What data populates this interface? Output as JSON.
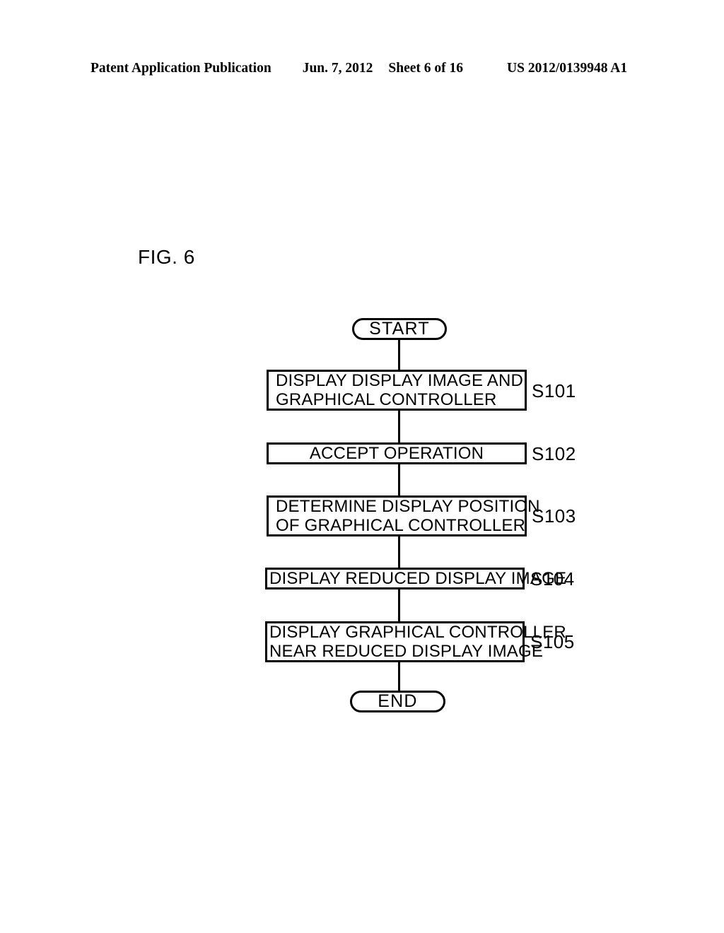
{
  "header": {
    "publication": "Patent Application Publication",
    "date": "Jun. 7, 2012",
    "sheet": "Sheet 6 of 16",
    "patent_number": "US 2012/0139948 A1"
  },
  "figure": {
    "label": "FIG. 6"
  },
  "flowchart": {
    "start": {
      "label": "START"
    },
    "end": {
      "label": "END"
    },
    "steps": [
      {
        "id": "S101",
        "line1": "DISPLAY DISPLAY IMAGE AND",
        "line2": "GRAPHICAL CONTROLLER"
      },
      {
        "id": "S102",
        "line1": "ACCEPT OPERATION",
        "line2": ""
      },
      {
        "id": "S103",
        "line1": "DETERMINE DISPLAY POSITION",
        "line2": "OF GRAPHICAL CONTROLLER"
      },
      {
        "id": "S104",
        "line1": "DISPLAY REDUCED DISPLAY IMAGE",
        "line2": ""
      },
      {
        "id": "S105",
        "line1": "DISPLAY GRAPHICAL CONTROLLER",
        "line2": "NEAR REDUCED DISPLAY IMAGE"
      }
    ]
  },
  "colors": {
    "ink": "#000000",
    "paper": "#ffffff"
  }
}
